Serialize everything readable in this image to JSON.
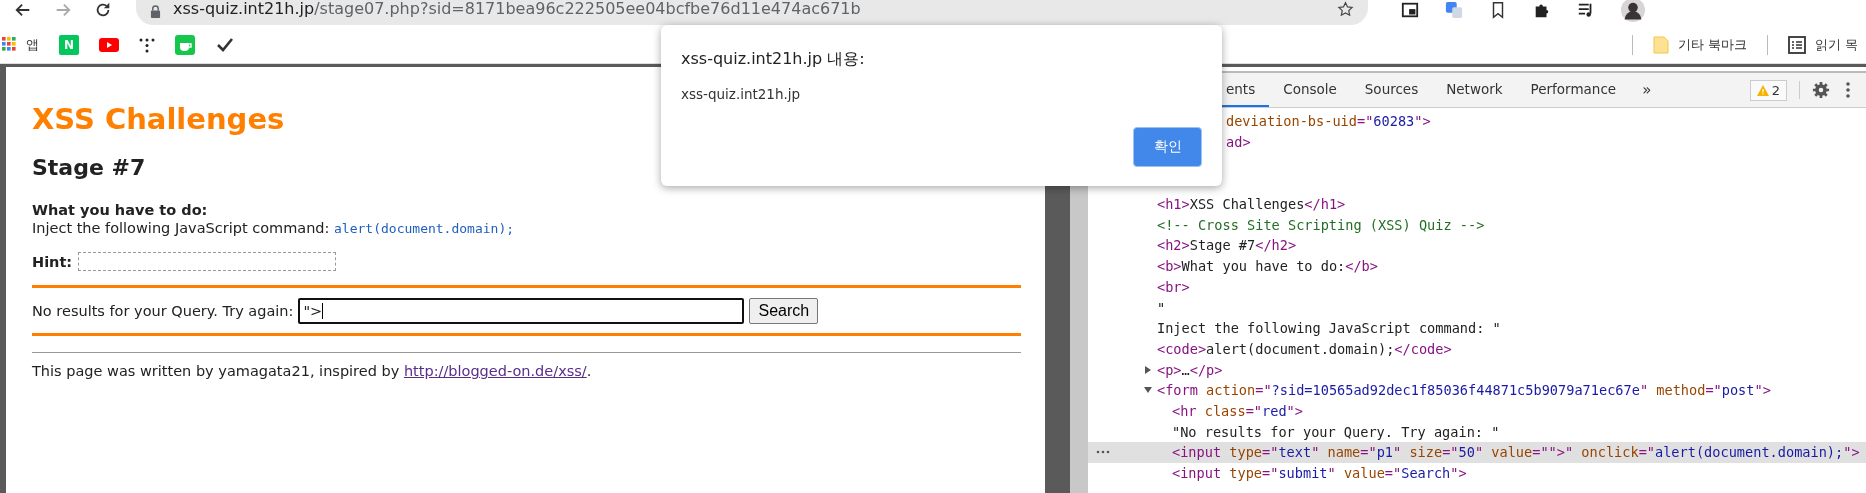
{
  "browser": {
    "url_host": "xss-quiz.int21h.jp",
    "url_path": "/stage07.php?sid=8171bea96c222505ee04bcfbe76d11e474ac671b",
    "bookmarks": [
      {
        "kind": "apps",
        "label": "앱"
      },
      {
        "kind": "letter",
        "label": "N"
      },
      {
        "kind": "video"
      },
      {
        "kind": "dots"
      },
      {
        "kind": "cup"
      },
      {
        "kind": "check"
      }
    ],
    "bookmarks_right": [
      {
        "kind": "folder",
        "label": "기타 북마크"
      },
      {
        "kind": "list",
        "label": "읽기 목"
      }
    ]
  },
  "page": {
    "title": "XSS Challenges",
    "stage": "Stage #7",
    "task_label": "What you have to do:",
    "task_text": "Inject the following JavaScript command:",
    "task_code": "alert(document.domain);",
    "hint_label": "Hint:",
    "query_label": "No results for your Query. Try again:",
    "query_value": "\">",
    "search_button": "Search",
    "footer_text": "This page was written by yamagata21, inspired by",
    "footer_link": "http://blogged-on.de/xss/",
    "footer_end": "."
  },
  "dialog": {
    "title": "xss-quiz.int21h.jp 내용:",
    "message": "xss-quiz.int21h.jp",
    "ok_button": "확인"
  },
  "devtools": {
    "tabs": [
      {
        "label": "ents",
        "selected": true
      },
      {
        "label": "Console",
        "selected": false
      },
      {
        "label": "Sources",
        "selected": false
      },
      {
        "label": "Network",
        "selected": false
      },
      {
        "label": "Performance",
        "selected": false
      }
    ],
    "more": "»",
    "warnings": "2",
    "clipped_lines": [
      [
        {
          "kind": "attr",
          "s": "deviation-bs-uid"
        },
        {
          "kind": "punct",
          "s": "=\""
        },
        {
          "kind": "val",
          "s": "60283"
        },
        {
          "kind": "punct",
          "s": "\">"
        }
      ],
      [
        {
          "kind": "tag",
          "s": "ad"
        },
        {
          "kind": "punct",
          "s": ">"
        }
      ]
    ],
    "nodes": [
      {
        "selected": false,
        "segments": [
          {
            "kind": "tag",
            "s": "<h1>"
          },
          {
            "kind": "text",
            "s": "XSS Challenges"
          },
          {
            "kind": "tag",
            "s": "</h1>"
          }
        ]
      },
      {
        "selected": false,
        "segments": [
          {
            "kind": "comment",
            "s": "<!-- Cross Site Scripting (XSS) Quiz -->"
          }
        ]
      },
      {
        "selected": false,
        "segments": [
          {
            "kind": "tag",
            "s": "<h2>"
          },
          {
            "kind": "text",
            "s": "Stage #7"
          },
          {
            "kind": "tag",
            "s": "</h2>"
          }
        ]
      },
      {
        "selected": false,
        "segments": [
          {
            "kind": "tag",
            "s": "<b>"
          },
          {
            "kind": "text",
            "s": "What you have to do:"
          },
          {
            "kind": "tag",
            "s": "</b>"
          }
        ]
      },
      {
        "selected": false,
        "segments": [
          {
            "kind": "tag",
            "s": "<br>"
          }
        ]
      },
      {
        "selected": false,
        "segments": [
          {
            "kind": "text",
            "s": "\""
          }
        ]
      },
      {
        "selected": false,
        "segments": [
          {
            "kind": "text",
            "s": "Inject the following JavaScript command: \""
          }
        ]
      },
      {
        "selected": false,
        "segments": [
          {
            "kind": "tag",
            "s": "<code>"
          },
          {
            "kind": "text",
            "s": "alert(document.domain);"
          },
          {
            "kind": "tag",
            "s": "</code>"
          }
        ]
      },
      {
        "selected": false,
        "expanded": false,
        "segments": [
          {
            "kind": "tag",
            "s": "<p>"
          },
          {
            "kind": "text",
            "s": "…"
          },
          {
            "kind": "tag",
            "s": "</p>"
          }
        ]
      },
      {
        "selected": false,
        "expanded": true,
        "segments": [
          {
            "kind": "tag",
            "s": "<form "
          },
          {
            "kind": "attr",
            "s": "action"
          },
          {
            "kind": "punct",
            "s": "=\""
          },
          {
            "kind": "val",
            "s": "?sid=10565ad92dec1f85036f44871c5b9079a71ec67e"
          },
          {
            "kind": "punct",
            "s": "\" "
          },
          {
            "kind": "attr",
            "s": "method"
          },
          {
            "kind": "punct",
            "s": "=\""
          },
          {
            "kind": "val",
            "s": "post"
          },
          {
            "kind": "punct",
            "s": "\">"
          }
        ],
        "children": [
          {
            "selected": false,
            "segments": [
              {
                "kind": "tag",
                "s": "<hr "
              },
              {
                "kind": "attr",
                "s": "class"
              },
              {
                "kind": "punct",
                "s": "=\""
              },
              {
                "kind": "val",
                "s": "red"
              },
              {
                "kind": "punct",
                "s": "\">"
              }
            ]
          },
          {
            "selected": false,
            "segments": [
              {
                "kind": "text",
                "s": "\"No results for your Query. Try again: \""
              }
            ]
          },
          {
            "selected": true,
            "segments": [
              {
                "kind": "tag",
                "s": "<input "
              },
              {
                "kind": "attr",
                "s": "type"
              },
              {
                "kind": "punct",
                "s": "=\""
              },
              {
                "kind": "val",
                "s": "text"
              },
              {
                "kind": "punct",
                "s": "\" "
              },
              {
                "kind": "attr",
                "s": "name"
              },
              {
                "kind": "punct",
                "s": "=\""
              },
              {
                "kind": "val",
                "s": "p1"
              },
              {
                "kind": "punct",
                "s": "\" "
              },
              {
                "kind": "attr",
                "s": "size"
              },
              {
                "kind": "punct",
                "s": "=\""
              },
              {
                "kind": "val",
                "s": "50"
              },
              {
                "kind": "punct",
                "s": "\" "
              },
              {
                "kind": "attr",
                "s": "value"
              },
              {
                "kind": "punct",
                "s": "=\"\">\" "
              },
              {
                "kind": "attr",
                "s": "onclick"
              },
              {
                "kind": "punct",
                "s": "=\""
              },
              {
                "kind": "val",
                "s": "alert(document.domain);"
              },
              {
                "kind": "punct",
                "s": "\">"
              }
            ]
          },
          {
            "selected": false,
            "segments": [
              {
                "kind": "tag",
                "s": "<input "
              },
              {
                "kind": "attr",
                "s": "type"
              },
              {
                "kind": "punct",
                "s": "=\""
              },
              {
                "kind": "val",
                "s": "submit"
              },
              {
                "kind": "punct",
                "s": "\" "
              },
              {
                "kind": "attr",
                "s": "value"
              },
              {
                "kind": "punct",
                "s": "=\""
              },
              {
                "kind": "val",
                "s": "Search"
              },
              {
                "kind": "punct",
                "s": "\">"
              }
            ]
          }
        ]
      }
    ]
  }
}
